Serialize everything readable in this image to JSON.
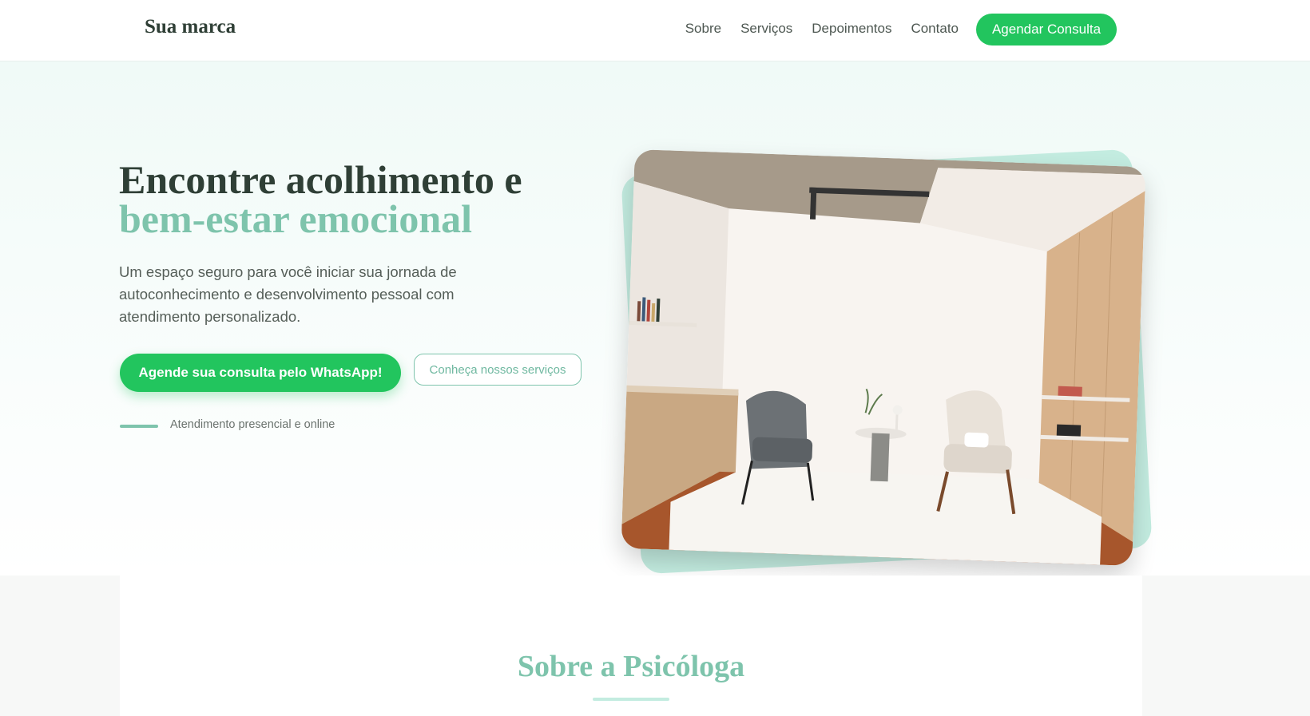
{
  "brand": {
    "name": "Sua marca"
  },
  "nav": {
    "links": [
      {
        "label": "Sobre"
      },
      {
        "label": "Serviços"
      },
      {
        "label": "Depoimentos"
      },
      {
        "label": "Contato"
      }
    ],
    "cta_label": "Agendar Consulta"
  },
  "hero": {
    "title_line1": "Encontre acolhimento e",
    "title_line2": "bem-estar emocional",
    "subtitle": "Um espaço seguro para você iniciar sua jornada de autoconhecimento e desenvolvimento pessoal com atendimento personalizado.",
    "primary_button": "Agende sua consulta pelo WhatsApp!",
    "secondary_button": "Conheça nossos serviços",
    "attendance_note": "Atendimento presencial e online",
    "image_icon": "therapy-room-photo"
  },
  "about": {
    "title": "Sobre a Psicóloga"
  },
  "colors": {
    "primary_green": "#22c55e",
    "accent_teal": "#7ec4ac",
    "light_teal": "#c3ece0",
    "heading_dark": "#2f3f36"
  }
}
